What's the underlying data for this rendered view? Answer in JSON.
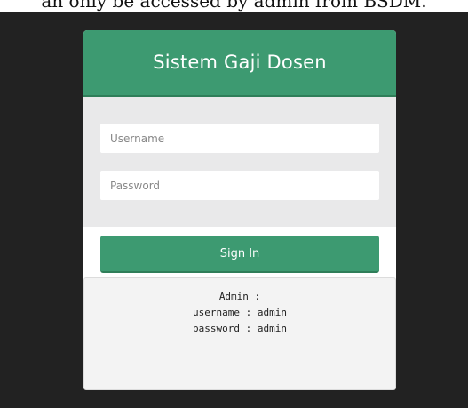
{
  "top_caption": "an only be accessed by admin from BSDM.",
  "login": {
    "title": "Sistem Gaji Dosen",
    "username_placeholder": "Username",
    "password_placeholder": "Password",
    "signin_label": "Sign In"
  },
  "info": {
    "line1": "Admin :",
    "line2": "username : admin",
    "line3": "password : admin"
  },
  "colors": {
    "accent": "#3d9a71",
    "background": "#222222"
  }
}
